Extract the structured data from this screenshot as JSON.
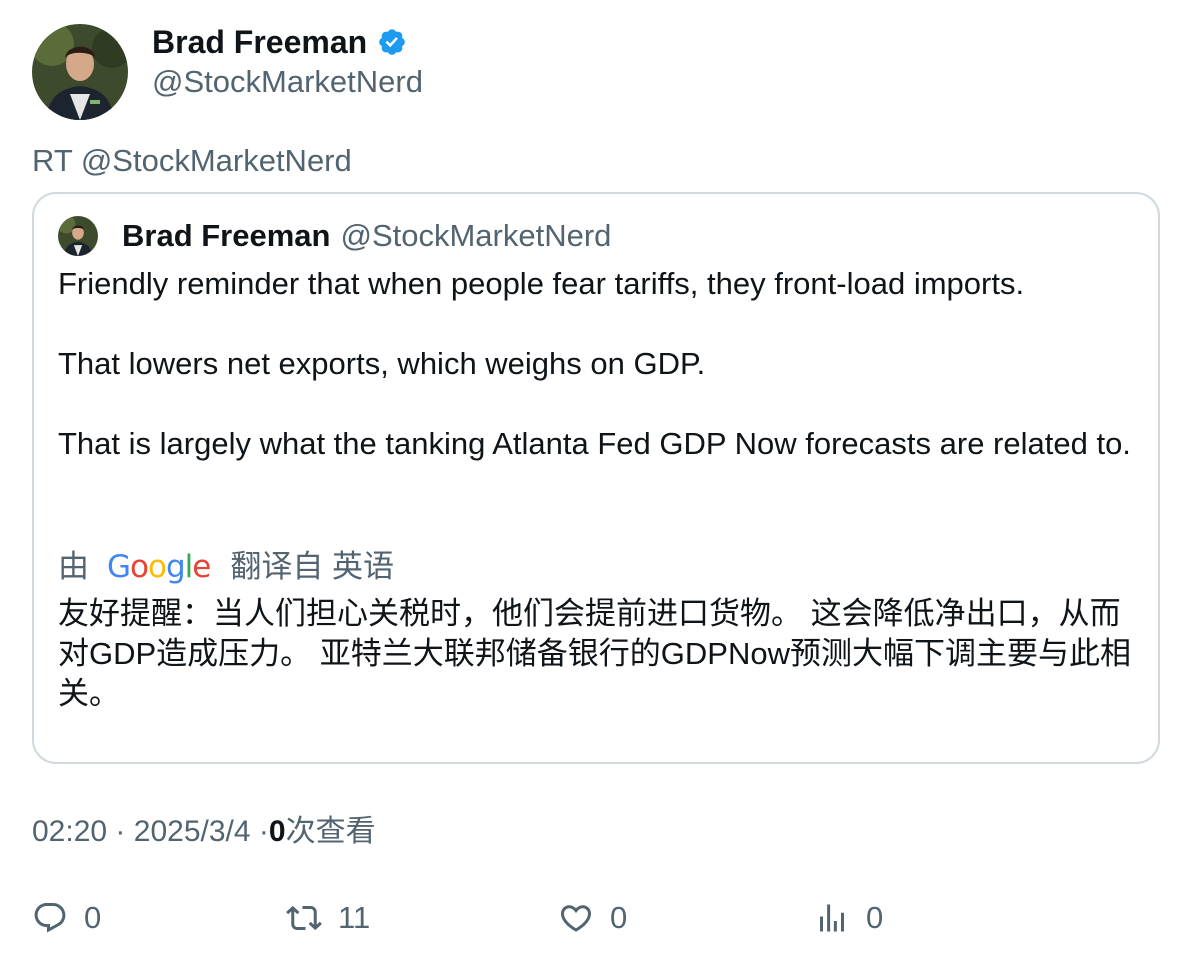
{
  "author": {
    "name": "Brad Freeman",
    "handle": "@StockMarketNerd",
    "verified_color": "#1d9bf0"
  },
  "retweet_label": "RT @StockMarketNerd",
  "quoted_tweet": {
    "name": "Brad Freeman",
    "handle": "@StockMarketNerd",
    "paragraphs": [
      "Friendly reminder that when people fear tariffs, they front-load imports.",
      "That lowers net exports, which weighs on GDP.",
      "That is largely what the tanking Atlanta Fed GDP Now forecasts are related to."
    ],
    "translation": {
      "by_label": "由",
      "provider": "Google",
      "from_label": "翻译自 英语",
      "text": "友好提醒：当人们担心关税时，他们会提前进口货物。 这会降低净出口，从而对GDP造成压力。 亚特兰大联邦储备银行的GDPNow预测大幅下调主要与此相关。"
    }
  },
  "meta": {
    "time": "02:20",
    "date": "2025/3/4",
    "views_count": "0",
    "views_label": "次查看",
    "separator": "·"
  },
  "actions": {
    "replies": "0",
    "retweets": "11",
    "likes": "0",
    "views": "0"
  },
  "icons": {
    "avatar": "profile-photo",
    "verified": "verified-badge-icon",
    "reply": "reply-icon",
    "retweet": "retweet-icon",
    "like": "heart-icon",
    "views": "analytics-icon"
  }
}
